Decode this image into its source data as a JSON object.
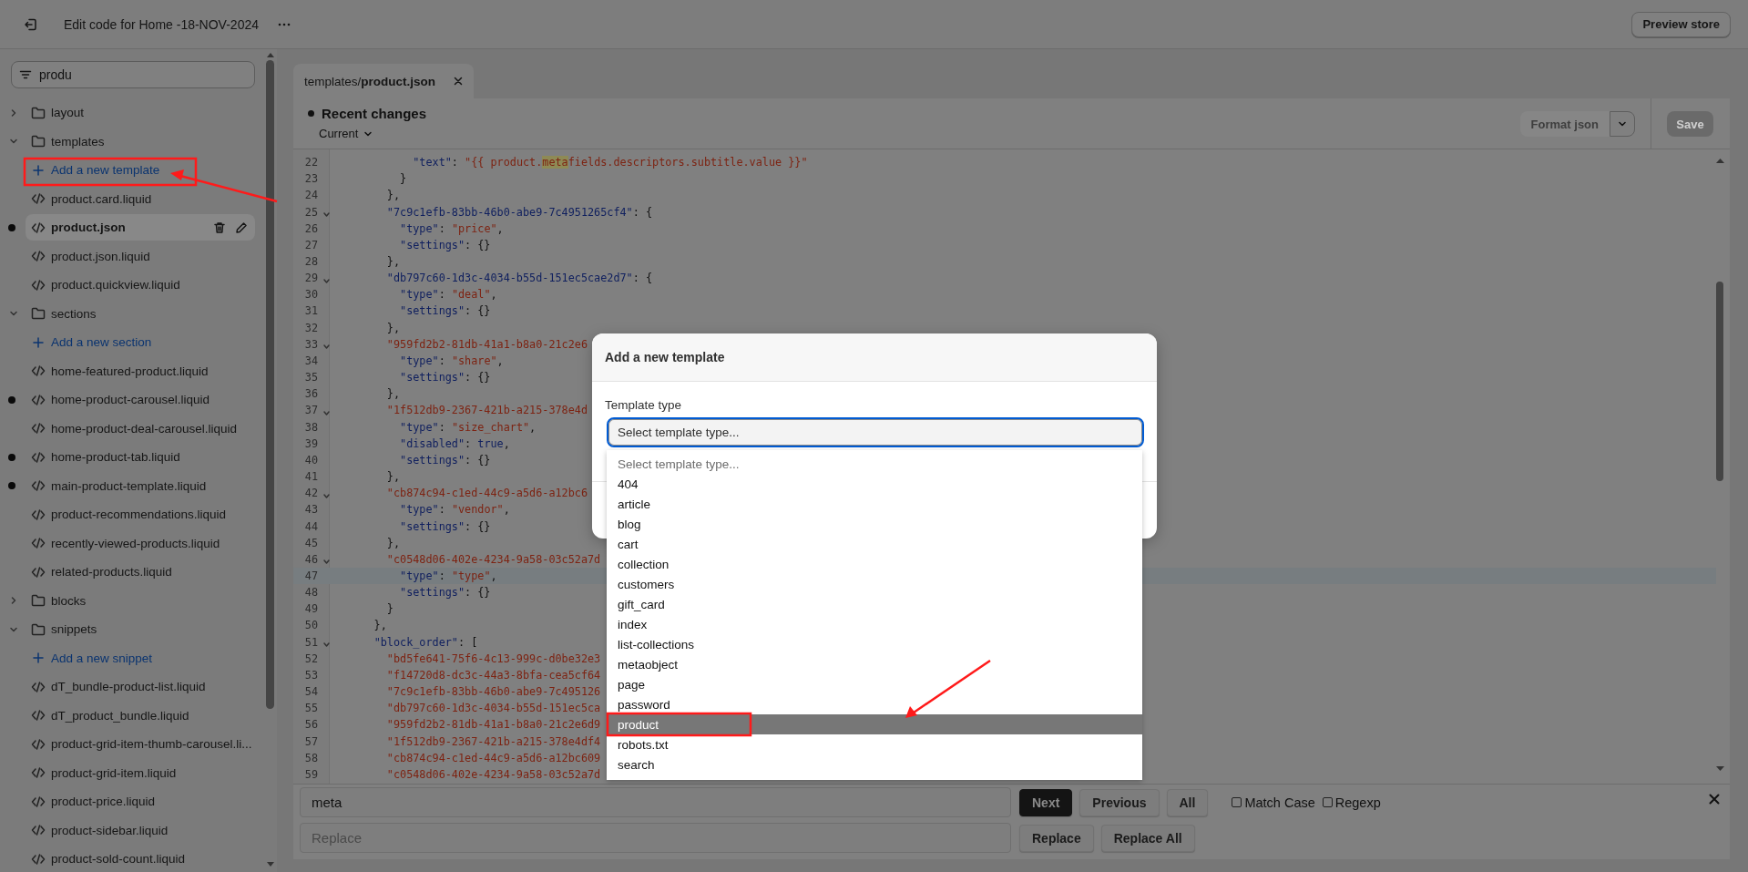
{
  "topbar": {
    "title": "Edit code for Home -18-NOV-2024",
    "preview_button": "Preview store"
  },
  "sidebar": {
    "search": {
      "value": "produ"
    },
    "tree": [
      {
        "kind": "folder",
        "label": "layout",
        "expanded": false
      },
      {
        "kind": "folder",
        "label": "templates",
        "expanded": true,
        "children": [
          {
            "kind": "add",
            "label": "Add a new template"
          },
          {
            "kind": "file",
            "label": "product.card.liquid",
            "modified": false,
            "selected": false
          },
          {
            "kind": "file",
            "label": "product.json",
            "modified": true,
            "selected": true
          },
          {
            "kind": "file",
            "label": "product.json.liquid",
            "modified": false,
            "selected": false
          },
          {
            "kind": "file",
            "label": "product.quickview.liquid",
            "modified": false,
            "selected": false
          }
        ]
      },
      {
        "kind": "folder",
        "label": "sections",
        "expanded": true,
        "children": [
          {
            "kind": "add",
            "label": "Add a new section"
          },
          {
            "kind": "file",
            "label": "home-featured-product.liquid",
            "modified": false,
            "selected": false
          },
          {
            "kind": "file",
            "label": "home-product-carousel.liquid",
            "modified": true,
            "selected": false
          },
          {
            "kind": "file",
            "label": "home-product-deal-carousel.liquid",
            "modified": false,
            "selected": false
          },
          {
            "kind": "file",
            "label": "home-product-tab.liquid",
            "modified": true,
            "selected": false
          },
          {
            "kind": "file",
            "label": "main-product-template.liquid",
            "modified": true,
            "selected": false
          },
          {
            "kind": "file",
            "label": "product-recommendations.liquid",
            "modified": false,
            "selected": false
          },
          {
            "kind": "file",
            "label": "recently-viewed-products.liquid",
            "modified": false,
            "selected": false
          },
          {
            "kind": "file",
            "label": "related-products.liquid",
            "modified": false,
            "selected": false
          }
        ]
      },
      {
        "kind": "folder",
        "label": "blocks",
        "expanded": false
      },
      {
        "kind": "folder",
        "label": "snippets",
        "expanded": true,
        "children": [
          {
            "kind": "add",
            "label": "Add a new snippet"
          },
          {
            "kind": "file",
            "label": "dT_bundle-product-list.liquid",
            "modified": false,
            "selected": false
          },
          {
            "kind": "file",
            "label": "dT_product_bundle.liquid",
            "modified": false,
            "selected": false
          },
          {
            "kind": "file",
            "label": "product-grid-item-thumb-carousel.li...",
            "modified": false,
            "selected": false
          },
          {
            "kind": "file",
            "label": "product-grid-item.liquid",
            "modified": false,
            "selected": false
          },
          {
            "kind": "file",
            "label": "product-price.liquid",
            "modified": false,
            "selected": false
          },
          {
            "kind": "file",
            "label": "product-sidebar.liquid",
            "modified": false,
            "selected": false
          },
          {
            "kind": "file",
            "label": "product-sold-count.liquid",
            "modified": false,
            "selected": false
          }
        ]
      }
    ]
  },
  "editor": {
    "tab": {
      "label": "templates/**product.json**"
    },
    "changes": {
      "title": "Recent changes",
      "version": "Current"
    },
    "format_button": {
      "label": "Format json",
      "disabled": true
    },
    "save_button": {
      "label": "Save",
      "disabled": true
    },
    "lines": [
      {
        "number": "22",
        "text": "            \"text\": \"{{ product.",
        "match": "meta",
        "rest": "fields.descriptors.subtitle.value }}\"",
        "foldable": false,
        "active": false
      },
      {
        "number": "23",
        "text": "          }",
        "foldable": false,
        "active": false
      },
      {
        "number": "24",
        "text": "        },",
        "foldable": false,
        "active": false
      },
      {
        "number": "25",
        "text": "        \"7c9c1efb-83bb-46b0-abe9-7c4951265cf4\": {",
        "foldable": true,
        "active": false
      },
      {
        "number": "26",
        "text": "          \"type\": \"price\",",
        "foldable": false,
        "active": false
      },
      {
        "number": "27",
        "text": "          \"settings\": {}",
        "foldable": false,
        "active": false
      },
      {
        "number": "28",
        "text": "        },",
        "foldable": false,
        "active": false
      },
      {
        "number": "29",
        "text": "        \"db797c60-1d3c-4034-b55d-151ec5cae2d7\": {",
        "foldable": true,
        "active": false
      },
      {
        "number": "30",
        "text": "          \"type\": \"deal\",",
        "foldable": false,
        "active": false
      },
      {
        "number": "31",
        "text": "          \"settings\": {}",
        "foldable": false,
        "active": false
      },
      {
        "number": "32",
        "text": "        },",
        "foldable": false,
        "active": false
      },
      {
        "number": "33",
        "text": "        \"959fd2b2-81db-41a1-b8a0-21c2e6",
        "foldable": true,
        "active": false
      },
      {
        "number": "34",
        "text": "          \"type\": \"share\",",
        "foldable": false,
        "active": false
      },
      {
        "number": "35",
        "text": "          \"settings\": {}",
        "foldable": false,
        "active": false
      },
      {
        "number": "36",
        "text": "        },",
        "foldable": false,
        "active": false
      },
      {
        "number": "37",
        "text": "        \"1f512db9-2367-421b-a215-378e4d",
        "foldable": true,
        "active": false
      },
      {
        "number": "38",
        "text": "          \"type\": \"size_chart\",",
        "foldable": false,
        "active": false
      },
      {
        "number": "39",
        "text": "          \"disabled\": true,",
        "foldable": false,
        "active": false
      },
      {
        "number": "40",
        "text": "          \"settings\": {}",
        "foldable": false,
        "active": false
      },
      {
        "number": "41",
        "text": "        },",
        "foldable": false,
        "active": false
      },
      {
        "number": "42",
        "text": "        \"cb874c94-c1ed-44c9-a5d6-a12bc6",
        "foldable": true,
        "active": false
      },
      {
        "number": "43",
        "text": "          \"type\": \"vendor\",",
        "foldable": false,
        "active": false
      },
      {
        "number": "44",
        "text": "          \"settings\": {}",
        "foldable": false,
        "active": false
      },
      {
        "number": "45",
        "text": "        },",
        "foldable": false,
        "active": false
      },
      {
        "number": "46",
        "text": "        \"c0548d06-402e-4234-9a58-03c52a7d",
        "foldable": true,
        "active": false
      },
      {
        "number": "47",
        "text": "          \"type\": \"type\",",
        "foldable": false,
        "active": true
      },
      {
        "number": "48",
        "text": "          \"settings\": {}",
        "foldable": false,
        "active": false
      },
      {
        "number": "49",
        "text": "        }",
        "foldable": false,
        "active": false
      },
      {
        "number": "50",
        "text": "      },",
        "foldable": false,
        "active": false
      },
      {
        "number": "51",
        "text": "      \"block_order\": [",
        "foldable": true,
        "active": false
      },
      {
        "number": "52",
        "text": "        \"bd5fe641-75f6-4c13-999c-d0be32e3",
        "foldable": false,
        "active": false
      },
      {
        "number": "53",
        "text": "        \"f14720d8-dc3c-44a3-8bfa-cea5cf64",
        "foldable": false,
        "active": false
      },
      {
        "number": "54",
        "text": "        \"7c9c1efb-83bb-46b0-abe9-7c495126",
        "foldable": false,
        "active": false
      },
      {
        "number": "55",
        "text": "        \"db797c60-1d3c-4034-b55d-151ec5ca",
        "foldable": false,
        "active": false
      },
      {
        "number": "56",
        "text": "        \"959fd2b2-81db-41a1-b8a0-21c2e6d9",
        "foldable": false,
        "active": false
      },
      {
        "number": "57",
        "text": "        \"1f512db9-2367-421b-a215-378e4df4",
        "foldable": false,
        "active": false
      },
      {
        "number": "58",
        "text": "        \"cb874c94-c1ed-44c9-a5d6-a12bc609",
        "foldable": false,
        "active": false
      },
      {
        "number": "59",
        "text": "        \"c0548d06-402e-4234-9a58-03c52a7d",
        "foldable": false,
        "active": false
      }
    ],
    "find": {
      "query": "meta",
      "replace_placeholder": "Replace",
      "buttons": [
        {
          "label": "Next",
          "primary": true
        },
        {
          "label": "Previous",
          "primary": false
        },
        {
          "label": "All",
          "primary": false
        }
      ],
      "options": [
        {
          "label": "Match Case",
          "checked": false
        },
        {
          "label": "Regexp",
          "checked": false
        }
      ],
      "replace_buttons": [
        "Replace",
        "Replace All"
      ]
    }
  },
  "dialog": {
    "title": "Add a new template",
    "field_label": "Template type",
    "select_value": "Select template type...",
    "options": [
      {
        "label": "Select template type...",
        "disabled": true,
        "selected": false
      },
      {
        "label": "404",
        "disabled": false,
        "selected": false
      },
      {
        "label": "article",
        "disabled": false,
        "selected": false
      },
      {
        "label": "blog",
        "disabled": false,
        "selected": false
      },
      {
        "label": "cart",
        "disabled": false,
        "selected": false
      },
      {
        "label": "collection",
        "disabled": false,
        "selected": false
      },
      {
        "label": "customers",
        "disabled": false,
        "selected": false
      },
      {
        "label": "gift_card",
        "disabled": false,
        "selected": false
      },
      {
        "label": "index",
        "disabled": false,
        "selected": false
      },
      {
        "label": "list-collections",
        "disabled": false,
        "selected": false
      },
      {
        "label": "metaobject",
        "disabled": false,
        "selected": false
      },
      {
        "label": "page",
        "disabled": false,
        "selected": false
      },
      {
        "label": "password",
        "disabled": false,
        "selected": false
      },
      {
        "label": "product",
        "disabled": false,
        "selected": true
      },
      {
        "label": "robots.txt",
        "disabled": false,
        "selected": false
      },
      {
        "label": "search",
        "disabled": false,
        "selected": false
      }
    ]
  }
}
